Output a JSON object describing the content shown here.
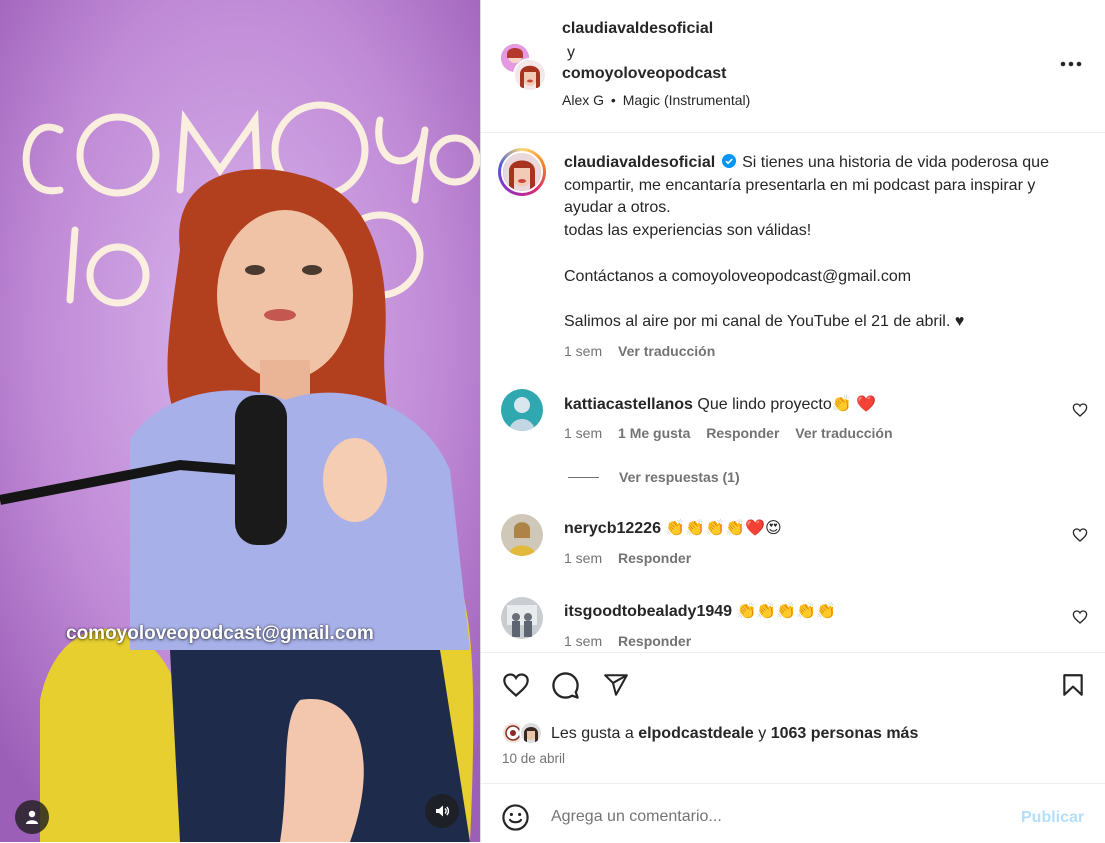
{
  "header": {
    "author_1": "claudiavaldesoficial",
    "joiner": "y",
    "author_2": "comoyoloveopodcast",
    "music_artist": "Alex G",
    "music_separator": "•",
    "music_track": "Magic (Instrumental)",
    "more_icon": "more-horizontal-icon"
  },
  "media": {
    "overlay_email": "comoyoloveopodcast@gmail.com",
    "neon_text": [
      "COMO yo",
      "lo VO"
    ],
    "profile_icon": "person-icon",
    "volume_icon": "speaker-icon"
  },
  "caption": {
    "username": "claudiavaldesoficial",
    "verified_icon": "verified-badge-icon",
    "lines": [
      "Si tienes una historia de vida poderosa que compartir, me encantaría presentarla en mi podcast para inspirar y ayudar a otros.",
      "todas las experiencias son válidas!",
      "",
      "Contáctanos a comoyoloveopodcast@gmail.com",
      "",
      "Salimos al aire por mi canal de YouTube el 21 de abril. ♥"
    ],
    "time": "1 sem",
    "translate": "Ver traducción"
  },
  "comments": [
    {
      "username": "kattiacastellanos",
      "text": "Que lindo proyecto👏 ❤️",
      "time": "1 sem",
      "likes": "1 Me gusta",
      "reply": "Responder",
      "translate": "Ver traducción",
      "view_replies": "Ver respuestas (1)"
    },
    {
      "username": "nerycb12226",
      "text": "👏👏👏👏❤️😍",
      "time": "1 sem",
      "reply": "Responder"
    },
    {
      "username": "itsgoodtobealady1949",
      "text": "👏👏👏👏👏",
      "time": "1 sem",
      "reply": "Responder"
    }
  ],
  "actions": {
    "like_icon": "heart-icon",
    "comment_icon": "comment-icon",
    "share_icon": "send-icon",
    "save_icon": "bookmark-icon",
    "likes_prefix": "Les gusta a",
    "likes_user": "elpodcastdeale",
    "likes_joiner": "y",
    "likes_rest": "1063 personas más",
    "date": "10 de abril"
  },
  "composer": {
    "emoji_icon": "emoji-icon",
    "placeholder": "Agrega un comentario...",
    "publish": "Publicar"
  },
  "colors": {
    "accent_blue": "#0095f6",
    "publish_disabled": "#b2dffc",
    "muted_text": "#737373",
    "heart_red": "#ed4956"
  }
}
